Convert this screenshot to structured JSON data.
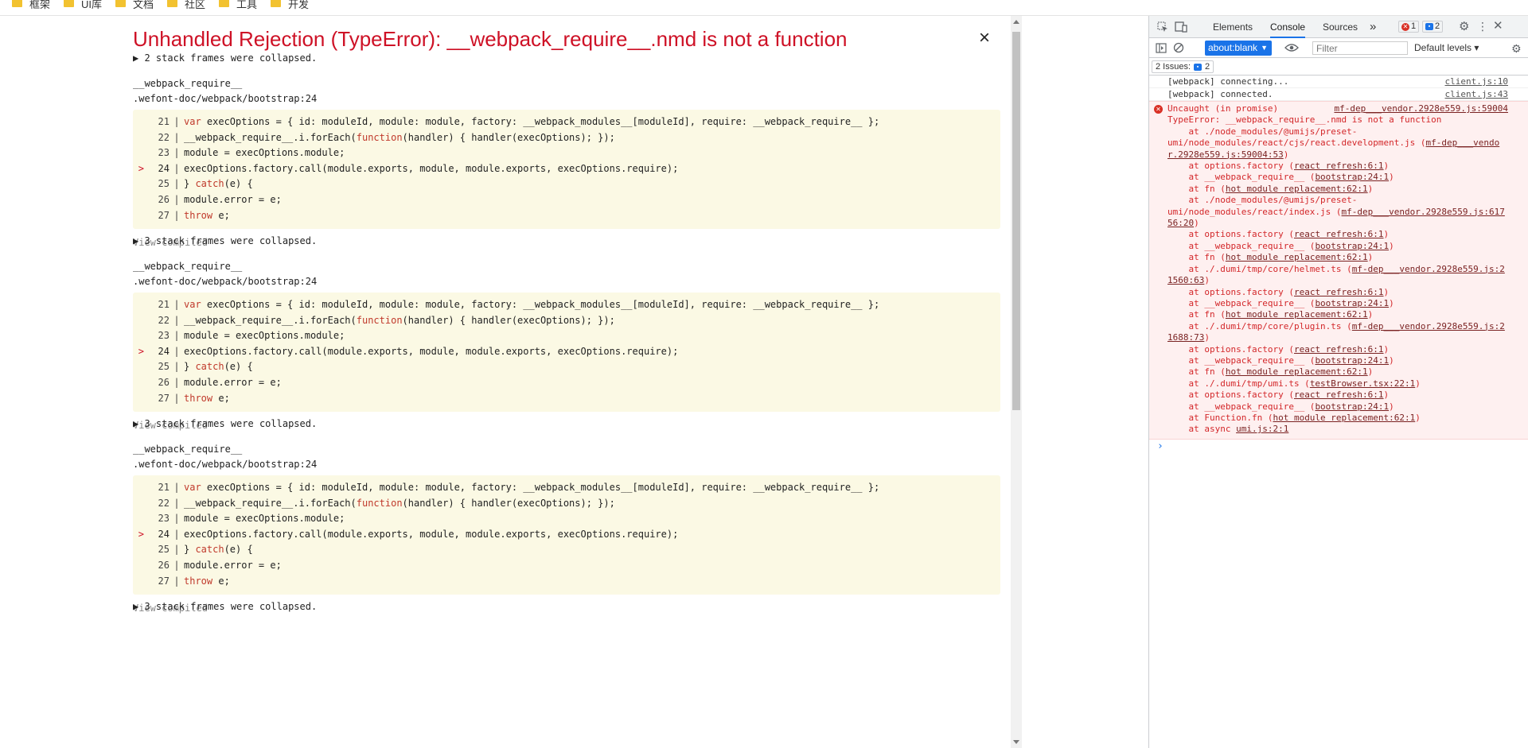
{
  "bookmarks": [
    {
      "label": "框架"
    },
    {
      "label": "UI库"
    },
    {
      "label": "文档"
    },
    {
      "label": "社区"
    },
    {
      "label": "工具"
    },
    {
      "label": "开发"
    }
  ],
  "overlay": {
    "title": "Unhandled Rejection (TypeError): __webpack_require__.nmd is not a function",
    "close": "×",
    "sections": [
      {
        "collapsed": "▶ 2 stack frames were collapsed.",
        "fn": "__webpack_require__",
        "file": ".wefont-doc/webpack/bootstrap:24",
        "view": "View compiled"
      },
      {
        "collapsed": "▶ 3 stack frames were collapsed.",
        "fn": "__webpack_require__",
        "file": ".wefont-doc/webpack/bootstrap:24",
        "view": "View compiled"
      },
      {
        "collapsed": "▶ 3 stack frames were collapsed.",
        "fn": "__webpack_require__",
        "file": ".wefont-doc/webpack/bootstrap:24",
        "view": "View compiled"
      }
    ],
    "last_collapsed": "▶ 3 stack frames were collapsed.",
    "code_lines": [
      {
        "n": "21",
        "sep": "|",
        "mark": "",
        "pre": "",
        "kw": "var",
        "post": " execOptions = { id: moduleId, module: module, factory: __webpack_modules__[moduleId], require: __webpack_require__ };"
      },
      {
        "n": "22",
        "sep": "|",
        "mark": "",
        "pre": "__webpack_require__.i.forEach(",
        "kw": "function",
        "post": "(handler) { handler(execOptions); });"
      },
      {
        "n": "23",
        "sep": "|",
        "mark": "",
        "pre": "module = execOptions.module;",
        "kw": "",
        "post": ""
      },
      {
        "n": "24",
        "sep": "|",
        "mark": ">",
        "pre": "execOptions.factory.call(module.exports, module, module.exports, execOptions.require);",
        "kw": "",
        "post": ""
      },
      {
        "n": "25",
        "sep": "|",
        "mark": "",
        "pre": "} ",
        "kw": "catch",
        "post": "(e) {"
      },
      {
        "n": "26",
        "sep": "|",
        "mark": "",
        "pre": "module.error = e;",
        "kw": "",
        "post": ""
      },
      {
        "n": "27",
        "sep": "|",
        "mark": "",
        "pre": "",
        "kw": "throw",
        "post": " e;"
      }
    ]
  },
  "devtools": {
    "tabs": [
      "Elements",
      "Console",
      "Sources"
    ],
    "active_tab": "Console",
    "more": "»",
    "error_count": "1",
    "warn_count": "2",
    "context": "about:blank",
    "filter_placeholder": "Filter",
    "levels": "Default levels ▾",
    "issues": "2 Issues:",
    "issues_count": "2",
    "logs": [
      {
        "text": "[webpack] connecting...",
        "src": "client.js:10"
      },
      {
        "text": "[webpack] connected.",
        "src": "client.js:43"
      }
    ],
    "error": {
      "head": "Uncaught (in promise)",
      "head_src": "mf-dep___vendor.2928e559.js:59004",
      "lines": [
        {
          "t": "TypeError: __webpack_require__.nmd is not a function",
          "l": "",
          "a": ""
        },
        {
          "t": "    at ./node_modules/@umijs/preset-",
          "l": "",
          "a": ""
        },
        {
          "t": "umi/node_modules/react/cjs/react.development.js (",
          "l": "mf-dep___vendo",
          "a": ""
        },
        {
          "t": "",
          "l": "r.2928e559.js:59004:53",
          "a": ")"
        },
        {
          "t": "    at options.factory (",
          "l": "react refresh:6:1",
          "a": ")"
        },
        {
          "t": "    at __webpack_require__ (",
          "l": "bootstrap:24:1",
          "a": ")"
        },
        {
          "t": "    at fn (",
          "l": "hot module replacement:62:1",
          "a": ")"
        },
        {
          "t": "    at ./node_modules/@umijs/preset-",
          "l": "",
          "a": ""
        },
        {
          "t": "umi/node_modules/react/index.js (",
          "l": "mf-dep___vendor.2928e559.js:617",
          "a": ""
        },
        {
          "t": "",
          "l": "56:20",
          "a": ")"
        },
        {
          "t": "    at options.factory (",
          "l": "react refresh:6:1",
          "a": ")"
        },
        {
          "t": "    at __webpack_require__ (",
          "l": "bootstrap:24:1",
          "a": ")"
        },
        {
          "t": "    at fn (",
          "l": "hot module replacement:62:1",
          "a": ")"
        },
        {
          "t": "    at ./.dumi/tmp/core/helmet.ts (",
          "l": "mf-dep___vendor.2928e559.js:2",
          "a": ""
        },
        {
          "t": "",
          "l": "1560:63",
          "a": ")"
        },
        {
          "t": "    at options.factory (",
          "l": "react refresh:6:1",
          "a": ")"
        },
        {
          "t": "    at __webpack_require__ (",
          "l": "bootstrap:24:1",
          "a": ")"
        },
        {
          "t": "    at fn (",
          "l": "hot module replacement:62:1",
          "a": ")"
        },
        {
          "t": "    at ./.dumi/tmp/core/plugin.ts (",
          "l": "mf-dep___vendor.2928e559.js:2",
          "a": ""
        },
        {
          "t": "",
          "l": "1688:73",
          "a": ")"
        },
        {
          "t": "    at options.factory (",
          "l": "react refresh:6:1",
          "a": ")"
        },
        {
          "t": "    at __webpack_require__ (",
          "l": "bootstrap:24:1",
          "a": ")"
        },
        {
          "t": "    at fn (",
          "l": "hot module replacement:62:1",
          "a": ")"
        },
        {
          "t": "    at ./.dumi/tmp/umi.ts (",
          "l": "testBrowser.tsx:22:1",
          "a": ")"
        },
        {
          "t": "    at options.factory (",
          "l": "react refresh:6:1",
          "a": ")"
        },
        {
          "t": "    at __webpack_require__ (",
          "l": "bootstrap:24:1",
          "a": ")"
        },
        {
          "t": "    at Function.fn (",
          "l": "hot module replacement:62:1",
          "a": ")"
        },
        {
          "t": "    at async ",
          "l": "umi.js:2:1",
          "a": ""
        }
      ]
    },
    "prompt": "›"
  },
  "colors": {
    "error_red": "#ce1126",
    "code_bg": "#fbf9e4",
    "devtools_blue": "#1a73e8"
  }
}
